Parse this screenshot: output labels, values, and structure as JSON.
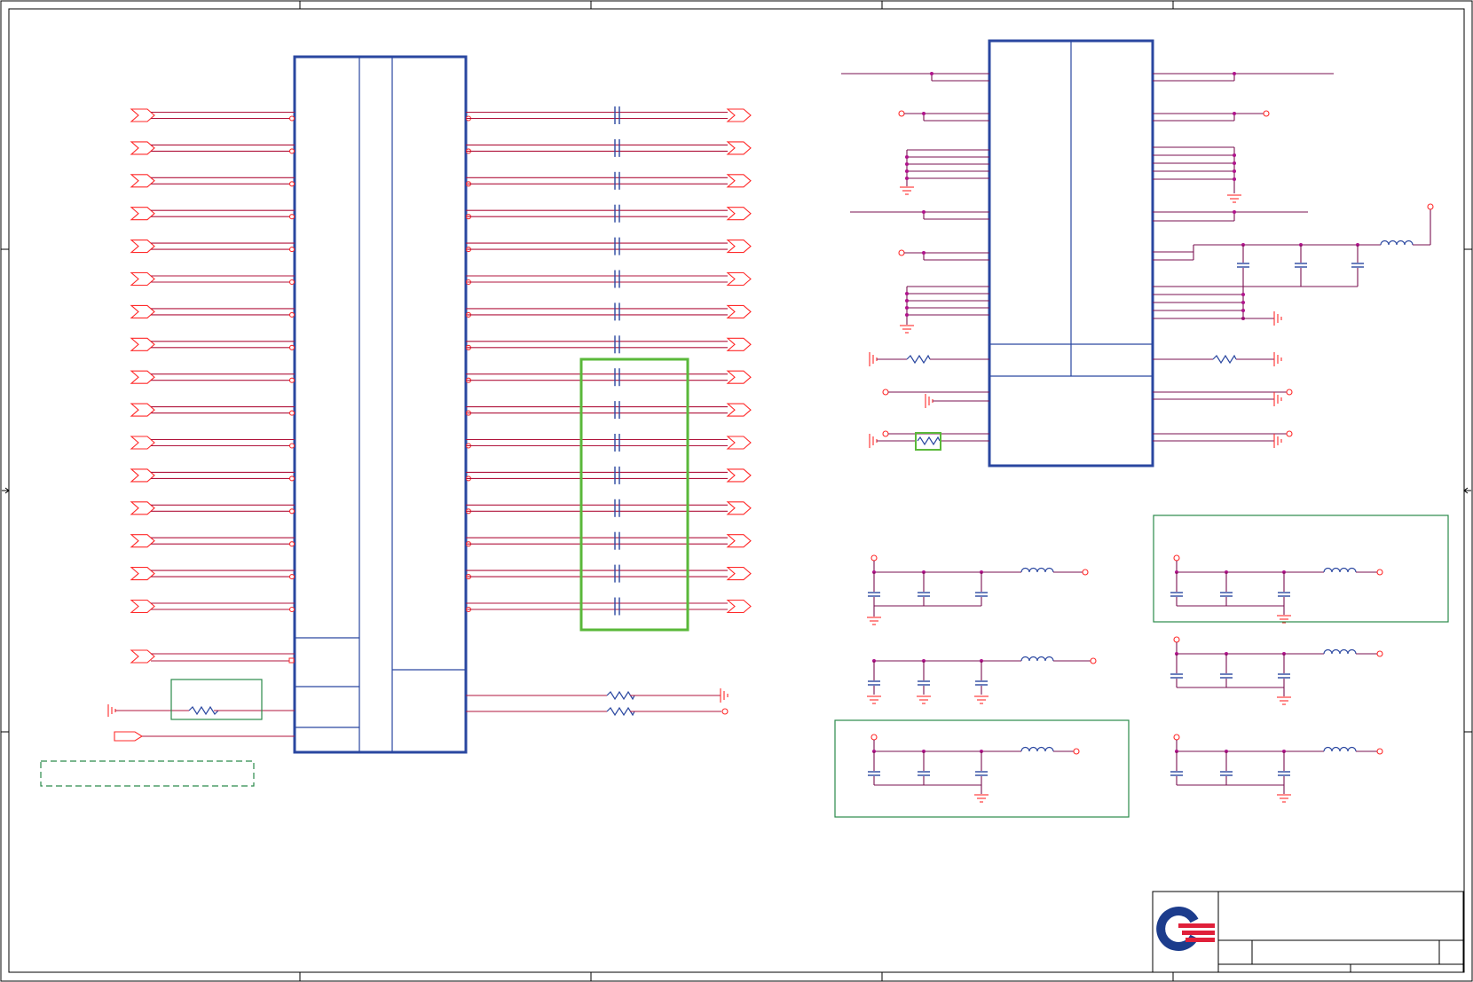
{
  "canvas": {
    "width": 1660,
    "height": 1107
  },
  "colors": {
    "wire": "#b0143c",
    "port": "#ff2a2a",
    "ic_outline": "#2a47a0",
    "highlight_green": "#5ab83a",
    "box_green": "#2a8a4a",
    "logo_blue": "#1c3c8c",
    "logo_red": "#e0203a"
  },
  "icons": {
    "logo": "company-logo-icon",
    "ground": "ground-icon",
    "capacitor": "capacitor-icon",
    "resistor": "resistor-icon",
    "inductor": "inductor-icon",
    "power_port": "power-port-icon"
  },
  "left_section": {
    "signal_pairs": 16,
    "ac_coupling_capacitors": 16,
    "highlighted_pairs": 8
  },
  "right_section": {
    "decoupling_filters": 6,
    "filter_capacitors_each": 3
  }
}
